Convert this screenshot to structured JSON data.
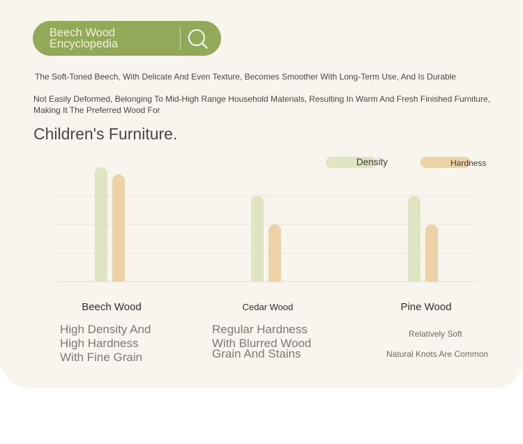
{
  "header": {
    "title_line1": "Beech Wood",
    "title_line2": "Encyclopedia",
    "search_icon": "search-icon"
  },
  "intro": {
    "line1": "The Soft-Toned Beech, With Delicate And Even Texture, Becomes Smoother With Long-Term Use, And Is Durable",
    "line2": "Not Easily Deformed, Belonging To Mid-High Range Household Materials, Resulting In Warm And Fresh Finished Furniture,",
    "line3": "Making It The Preferred Wood For",
    "headline": "Children's Furniture."
  },
  "chart_data": {
    "type": "bar",
    "categories": [
      "Beech Wood",
      "Cedar Wood",
      "Pine Wood"
    ],
    "series": [
      {
        "name": "Density",
        "values": [
          4.0,
          3.0,
          3.0
        ],
        "color": "#dfe4c2"
      },
      {
        "name": "Hardness",
        "values": [
          3.75,
          2.0,
          2.0
        ],
        "color": "#ecd2a7"
      }
    ],
    "ylim": [
      0,
      4
    ],
    "grid": true,
    "legend_position": "top-right",
    "title": "",
    "xlabel": "",
    "ylabel": ""
  },
  "descriptions": {
    "beech": [
      "High Density And",
      "High Hardness",
      "With Fine Grain"
    ],
    "cedar": [
      "Regular Hardness",
      "With Blurred Wood",
      "Grain And Stains"
    ],
    "pine": [
      "Relatively Soft",
      "Natural Knots Are Common"
    ]
  },
  "colors": {
    "accent": "#93a95a",
    "background": "#f8f4ee",
    "density": "#dfe4c2",
    "hardness": "#ecd2a7"
  }
}
